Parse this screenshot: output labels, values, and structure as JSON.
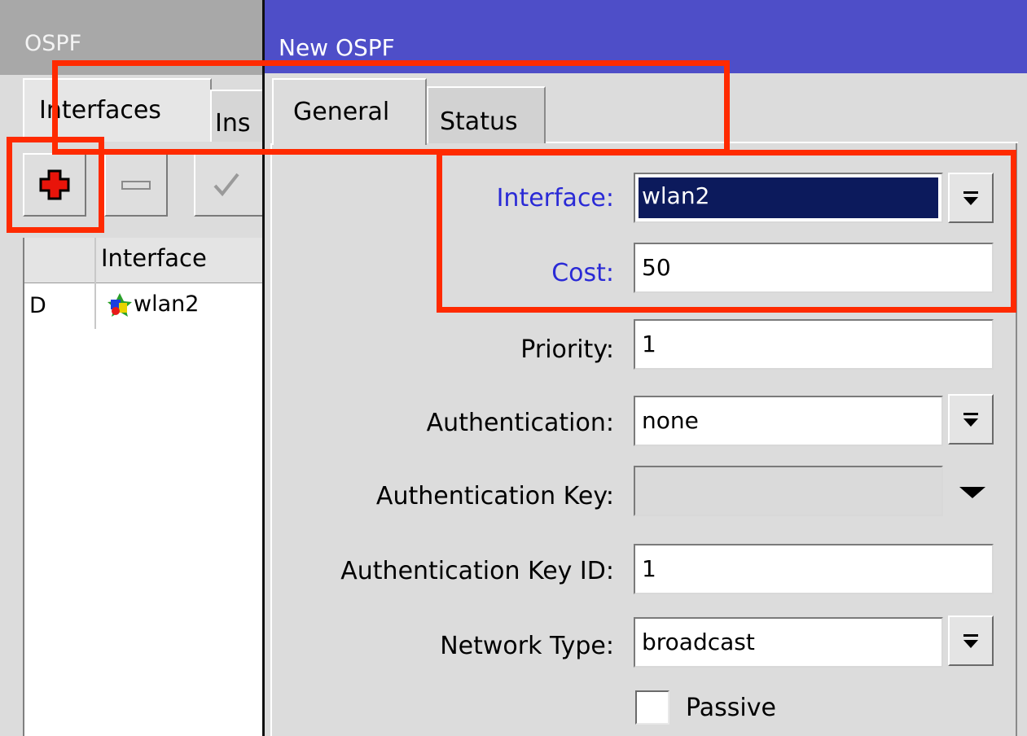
{
  "background_window": {
    "title": "OSPF",
    "tabs": [
      {
        "label": "Interfaces"
      },
      {
        "label": "Ins"
      }
    ],
    "toolbar": {
      "add": "add",
      "remove": "remove",
      "enable": "enable"
    },
    "list": {
      "headers": [
        "",
        "Interface"
      ],
      "rows": [
        {
          "flag": "D",
          "interface": "wlan2"
        }
      ]
    }
  },
  "dialog": {
    "title": "New OSPF",
    "tabs": [
      {
        "label": "General"
      },
      {
        "label": "Status"
      }
    ],
    "fields": {
      "interface": {
        "label": "Interface:",
        "value": "wlan2"
      },
      "cost": {
        "label": "Cost:",
        "value": "50"
      },
      "priority": {
        "label": "Priority:",
        "value": "1"
      },
      "authentication": {
        "label": "Authentication:",
        "value": "none"
      },
      "authentication_key": {
        "label": "Authentication Key:",
        "value": ""
      },
      "authentication_key_id": {
        "label": "Authentication Key ID:",
        "value": "1"
      },
      "network_type": {
        "label": "Network Type:",
        "value": "broadcast"
      },
      "passive": {
        "label": "Passive",
        "checked": false
      }
    }
  },
  "colors": {
    "annotation": "#ff2a00",
    "dialog_titlebar": "#4e4ec8",
    "highlight_label": "#2a2ad6",
    "selection": "#0c1a5c"
  },
  "icons": [
    "plus-icon",
    "minus-icon",
    "check-icon",
    "dropdown-arrow-icon",
    "interface-icon"
  ]
}
